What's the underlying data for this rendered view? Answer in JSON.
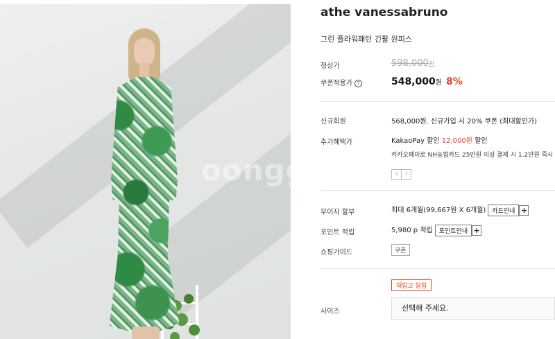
{
  "image": {
    "alt": "model wearing green floral wrap dress",
    "watermark": "oongg"
  },
  "product": {
    "brand": "athe vanessabruno",
    "name": "그린 플라워패턴 긴팔 원피스"
  },
  "price": {
    "regular_label": "정상가",
    "regular_value": "598,000",
    "regular_unit": "원",
    "coupon_label": "쿠폰적용가",
    "help_glyph": "?",
    "coupon_value": "548,000",
    "coupon_unit": "원",
    "discount": "8%"
  },
  "benefits": {
    "new_member_label": "신규회원",
    "new_member_text": "568,000원. 신규가입 시 20% 쿠폰 (최대할인가)",
    "extra_label": "추가혜택가",
    "kakao_prefix": "KakaoPay 할인 ",
    "kakao_amount": "12,000원",
    "kakao_suffix": " 할인",
    "card_text": "카카오페이로 NH농협카드 25만원 이상 결제 시 1.2만원 즉시",
    "prev": "‹",
    "next": "›"
  },
  "installment": {
    "label": "무이자 할부",
    "text": "최대 6개월(99,667원 X 6개월)",
    "button": "카드안내",
    "plus": "+"
  },
  "points": {
    "label": "포인트 적립",
    "text": "5,980 p 적립",
    "button": "포인트안내",
    "plus": "+"
  },
  "shopping": {
    "label": "쇼핑가이드",
    "tag": "쿠폰"
  },
  "restock": {
    "button": "재입고 알림"
  },
  "size": {
    "label": "사이즈",
    "placeholder": "선택해 주세요."
  },
  "colors": {
    "accent": "#e2432a",
    "divider": "#e2e2e2"
  }
}
